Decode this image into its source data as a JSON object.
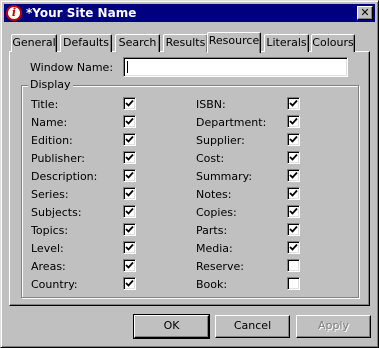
{
  "window": {
    "title": "*Your Site Name",
    "close_label": "✕",
    "app_icon_glyph": "i"
  },
  "tabs": [
    {
      "label": "General"
    },
    {
      "label": "Defaults"
    },
    {
      "label": "Search"
    },
    {
      "label": "Results"
    },
    {
      "label": "Resource",
      "active": true
    },
    {
      "label": "Literals"
    },
    {
      "label": "Colours"
    }
  ],
  "window_name": {
    "label": "Window Name:",
    "value": ""
  },
  "display": {
    "label": "Display",
    "left_fields": [
      {
        "label": "Title:",
        "checked": true
      },
      {
        "label": "Name:",
        "checked": true
      },
      {
        "label": "Edition:",
        "checked": true
      },
      {
        "label": "Publisher:",
        "checked": true
      },
      {
        "label": "Description:",
        "checked": true
      },
      {
        "label": "Series:",
        "checked": true
      },
      {
        "label": "Subjects:",
        "checked": true
      },
      {
        "label": "Topics:",
        "checked": true
      },
      {
        "label": "Level:",
        "checked": true
      },
      {
        "label": "Areas:",
        "checked": true
      },
      {
        "label": "Country:",
        "checked": true
      }
    ],
    "right_fields": [
      {
        "label": "ISBN:",
        "checked": true
      },
      {
        "label": "Department:",
        "checked": true
      },
      {
        "label": "Supplier:",
        "checked": true
      },
      {
        "label": "Cost:",
        "checked": true
      },
      {
        "label": "Summary:",
        "checked": true
      },
      {
        "label": "Notes:",
        "checked": true
      },
      {
        "label": "Copies:",
        "checked": true
      },
      {
        "label": "Parts:",
        "checked": true
      },
      {
        "label": "Media:",
        "checked": true
      },
      {
        "label": "Reserve:",
        "checked": false
      },
      {
        "label": "Book:",
        "checked": false
      }
    ]
  },
  "buttons": {
    "ok": "OK",
    "cancel": "Cancel",
    "apply": "Apply"
  }
}
